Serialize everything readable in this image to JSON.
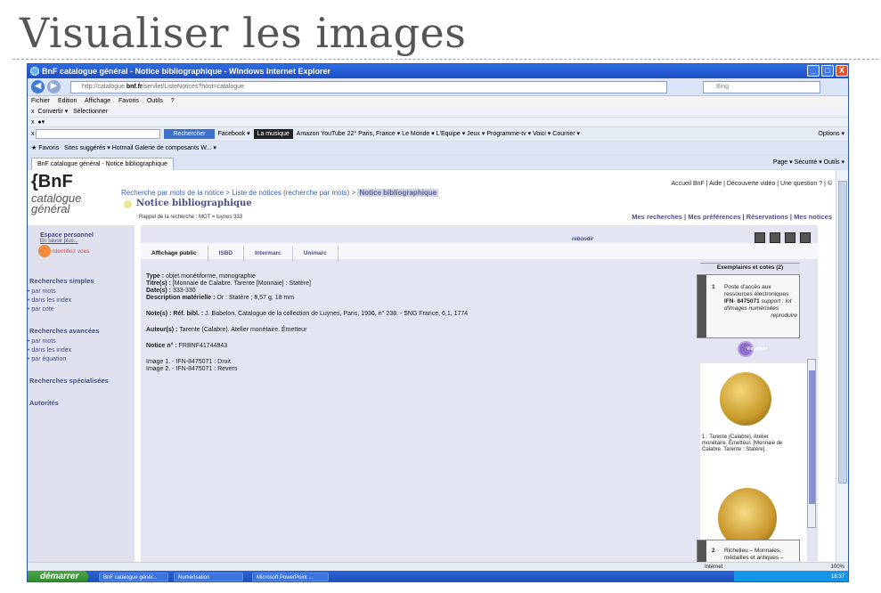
{
  "slide": {
    "title": "Visualiser les images"
  },
  "window": {
    "title": "BnF catalogue général - Notice bibliographique - Windows Internet Explorer",
    "url_prefix": "http://catalogue.",
    "url_domain": "bnf.fr",
    "url_suffix": "/servlet/ListeNotices?host=catalogue",
    "search_placeholder": "Bing",
    "min": "_",
    "max": "□",
    "close": "X"
  },
  "menu": [
    "Fichier",
    "Edition",
    "Affichage",
    "Favoris",
    "Outils",
    "?"
  ],
  "toolbar1": {
    "convert": "Convertir",
    "select": "Sélectionner"
  },
  "toolbar3": {
    "search_button": "Rechercher",
    "items": "Facebook ▾",
    "music": "La musique",
    "links": "Amazon  YouTube  22° Paris, France ▾  Le Monde ▾  L'Equipe ▾  Jeux ▾  Programme-tv ▾  Voici ▾  Courrier ▾",
    "options": "Options ▾"
  },
  "favorites": {
    "label": "Favoris",
    "items": "Sites suggérés ▾  Hotmail  Galerie de composants W... ▾"
  },
  "tab": {
    "label": "BnF catalogue général - Notice bibliographique"
  },
  "tabtools": "Page ▾  Sécurité ▾  Outils ▾",
  "page": {
    "logo": "{BnF",
    "logo_sub1": "catalogue",
    "logo_sub2": "général",
    "crumb_link": "Recherche par mots de la notice > Liste de notices (recherche par mots) >",
    "crumb_current": "Notice bibliographique",
    "heading": "Notice bibliographique",
    "toplinks": "Accueil BnF | Aide | Découverte vidéo | Une question ? | ©",
    "toplinks2": "Mes recherches | Mes préférences | Réservations | Mes notices",
    "rappel": "Rappel de la recherche : MOT = luynes 333"
  },
  "sidebar": {
    "espace": "Espace personnel",
    "espace_more": "En savoir plus...",
    "identify": "Identifiez vous",
    "simple": "Recherches simples",
    "simple_items": [
      "par mots",
      "dans les index",
      "par cote"
    ],
    "advanced": "Recherches avancées",
    "advanced_items": [
      "par mots",
      "dans les index",
      "par équation"
    ],
    "special": "Recherches spécialisées",
    "autorites": "Autorités"
  },
  "tabs": [
    "Affichage public",
    "ISBD",
    "Intermarc",
    "Unimarc"
  ],
  "rebondir": "rebondir",
  "notice": {
    "type_label": "Type :",
    "type": "objet monétiforme, monographie",
    "titre_label": "Titre(s) :",
    "titre": "[Monnaie de Calabre. Tarente [Monnaie] : Statère]",
    "date_label": "Date(s) :",
    "date": "333-330",
    "desc_label": "Description matérielle :",
    "desc": "Or : Statère ; 8,57 g, 18 mm",
    "note_label": "Note(s) :",
    "note_ref": "Réf. bibl. :",
    "note": "J. Babelon, Catalogue de la collection de Luynes, Paris, 1936, n° 238. - SNG France, 6,1, 1774",
    "auteur_label": "Auteur(s) :",
    "auteur": "Tarente (Calabre). Atelier monétaire. Émetteur",
    "noticen_label": "Notice n° :",
    "noticen": "FRBNF41744843",
    "image1": "Image 1. - IFN-8475071 : Droit",
    "image2": "Image 2. - IFN-8475071 : Revers"
  },
  "exemplaires": {
    "header": "Exemplaires et cotes (2)",
    "item1_num": "1",
    "item1_text": "Poste d'accès aux ressources électroniques",
    "item1_id": "IFN- 8475071",
    "item1_support": "support : lot d'images numérisées",
    "item1_reproduire": "reproduire",
    "visualiser": "Visualiser",
    "caption": "1 : Tarente (Calabre). Atelier monétaire. Émetteur. [Monnaie de Calabre. Tarente : Statère].",
    "item2_num": "2",
    "item2_text": "Richelieu – Monnaies, médailles et antiques –"
  },
  "status": {
    "internet": "Internet",
    "zoom": "100%"
  },
  "taskbar": {
    "start": "démarrer",
    "tasks": [
      "BnF catalogue génér...",
      "Numérisation",
      "Microsoft PowerPoint ..."
    ],
    "clock": "18:37"
  }
}
